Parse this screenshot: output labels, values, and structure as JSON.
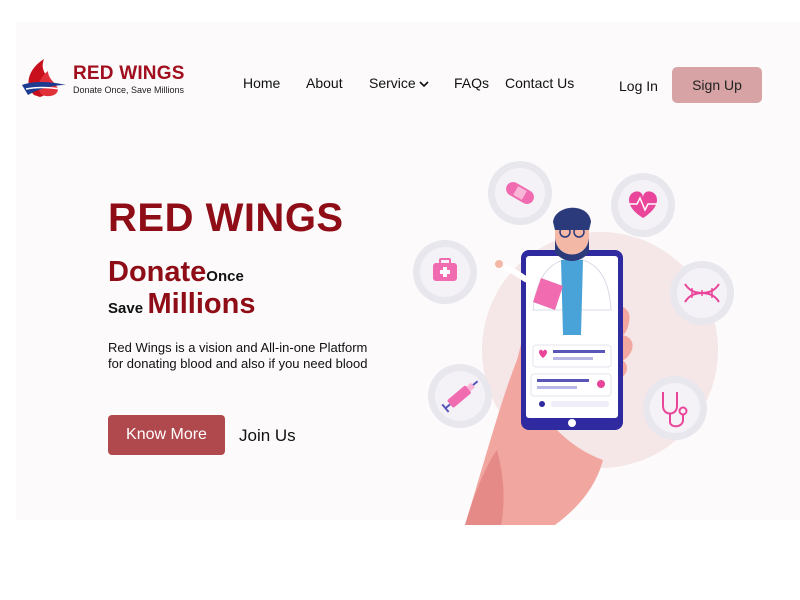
{
  "brand": {
    "name": "RED WINGS",
    "tagline": "Donate Once, Save Millions"
  },
  "nav": {
    "items": [
      "Home",
      "About",
      "Service",
      "FAQs",
      "Contact Us"
    ],
    "login_label": "Log In",
    "signup_label": "Sign Up"
  },
  "hero": {
    "title": "RED WINGS",
    "tag": {
      "donate": "Donate",
      "once": "Once",
      "save": "Save",
      "millions": "Millions"
    },
    "description": "Red Wings is a vision and All-in-one Platform for donating blood and also if you need blood",
    "know_more_label": "Know More",
    "join_us_label": "Join Us"
  },
  "colors": {
    "brand_red": "#8f0d17",
    "signup_bg": "#d7a3a5",
    "know_more_bg": "#b0494e",
    "accent_pink": "#e9459a"
  },
  "icons": [
    "bandage-icon",
    "heart-pulse-icon",
    "first-aid-kit-icon",
    "dna-icon",
    "syringe-icon",
    "stethoscope-icon"
  ]
}
